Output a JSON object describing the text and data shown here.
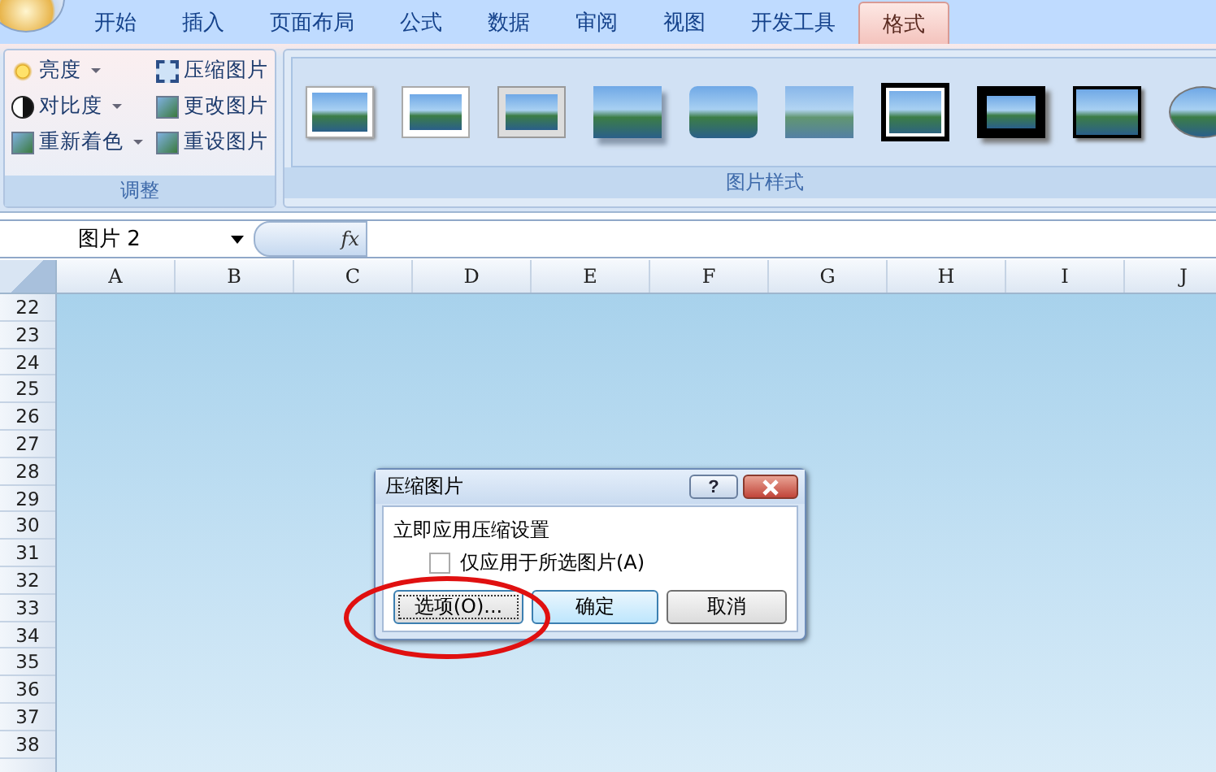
{
  "tabs": [
    {
      "label": "开始",
      "selected": false
    },
    {
      "label": "插入",
      "selected": false
    },
    {
      "label": "页面布局",
      "selected": false
    },
    {
      "label": "公式",
      "selected": false
    },
    {
      "label": "数据",
      "selected": false
    },
    {
      "label": "审阅",
      "selected": false
    },
    {
      "label": "视图",
      "selected": false
    },
    {
      "label": "开发工具",
      "selected": false
    },
    {
      "label": "格式",
      "selected": true
    }
  ],
  "adjust_group": {
    "label": "调整",
    "left_items": [
      {
        "label": "亮度",
        "kind": "sun"
      },
      {
        "label": "对比度",
        "kind": "contrast"
      },
      {
        "label": "重新着色",
        "kind": "recolor"
      }
    ],
    "right_items": [
      {
        "label": "压缩图片",
        "kind": "compress"
      },
      {
        "label": "更改图片",
        "kind": "change"
      },
      {
        "label": "重设图片",
        "kind": "reset"
      }
    ]
  },
  "styles_group": {
    "label": "图片样式"
  },
  "formula_bar": {
    "name_box": "图片 2",
    "fx": "fx"
  },
  "columns": [
    "A",
    "B",
    "C",
    "D",
    "E",
    "F",
    "G",
    "H",
    "I",
    "J"
  ],
  "rows": [
    "22",
    "23",
    "24",
    "25",
    "26",
    "27",
    "28",
    "29",
    "30",
    "31",
    "32",
    "33",
    "34",
    "35",
    "36",
    "37",
    "38"
  ],
  "dialog": {
    "title": "压缩图片",
    "help": "?",
    "heading": "立即应用压缩设置",
    "checkbox": {
      "label": "仅应用于所选图片(A)",
      "checked": false
    },
    "buttons": [
      "选项(O)...",
      "确定",
      "取消"
    ]
  }
}
